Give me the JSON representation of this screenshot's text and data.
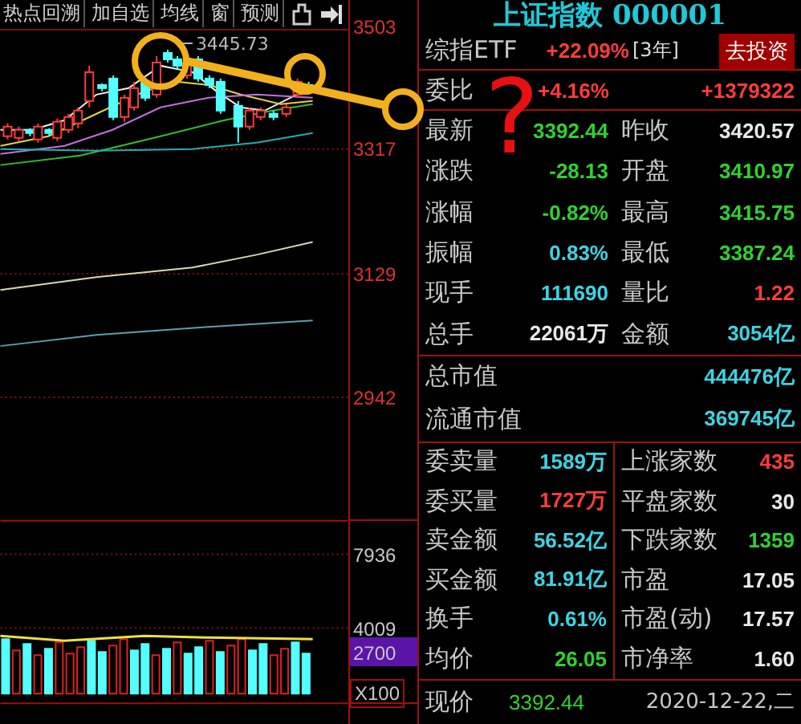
{
  "toolbar": {
    "tabs": [
      {
        "label": "热点回溯"
      },
      {
        "label": "加自选"
      },
      {
        "label": "均线"
      },
      {
        "label": "窗"
      },
      {
        "label": "预测"
      }
    ]
  },
  "chart": {
    "peak_label": "3445.73",
    "price_labels": [
      "3503",
      "3317",
      "3129",
      "2942"
    ],
    "volume_labels": [
      "7936",
      "4009"
    ],
    "volume_current": "2700",
    "volume_unit": "X100"
  },
  "annotation": {
    "mark": "?"
  },
  "quote": {
    "title": "上证指数 000001",
    "etf": {
      "label": "综指ETF",
      "change": "+22.09%",
      "period": "[3年]",
      "button": "去投资"
    },
    "ratio": {
      "label": "委比",
      "percent": "+4.16%",
      "diff": "+1379322"
    },
    "rows": [
      {
        "left": {
          "label": "最新",
          "value": "3392.44",
          "color": "#2fd22f"
        },
        "right": {
          "label": "昨收",
          "value": "3420.57",
          "color": "#e8e8e8"
        }
      },
      {
        "left": {
          "label": "涨跌",
          "value": "-28.13",
          "color": "#2fd22f"
        },
        "right": {
          "label": "开盘",
          "value": "3410.97",
          "color": "#2fd22f"
        }
      },
      {
        "left": {
          "label": "涨幅",
          "value": "-0.82%",
          "color": "#2fd22f"
        },
        "right": {
          "label": "最高",
          "value": "3415.75",
          "color": "#2fd22f"
        }
      },
      {
        "left": {
          "label": "振幅",
          "value": "0.83%",
          "color": "#3cd4e4"
        },
        "right": {
          "label": "最低",
          "value": "3387.24",
          "color": "#2fd22f"
        }
      },
      {
        "left": {
          "label": "现手",
          "value": "111690",
          "color": "#3cd4e4"
        },
        "right": {
          "label": "量比",
          "value": "1.22",
          "color": "#ff3c3c"
        }
      },
      {
        "left": {
          "label": "总手",
          "value": "22061万",
          "color": "#e8e8e8"
        },
        "right": {
          "label": "金额",
          "value": "3054亿",
          "color": "#3cd4e4"
        }
      }
    ],
    "caps": [
      {
        "label": "总市值",
        "value": "444476亿",
        "color": "#3cd4e4"
      },
      {
        "label": "流通市值",
        "value": "369745亿",
        "color": "#3cd4e4"
      }
    ],
    "grid": [
      {
        "left": {
          "label": "委卖量",
          "value": "1589万",
          "color": "#3cd4e4"
        },
        "right": {
          "label": "上涨家数",
          "value": "435",
          "color": "#ff3c3c"
        }
      },
      {
        "left": {
          "label": "委买量",
          "value": "1727万",
          "color": "#ff3c3c"
        },
        "right": {
          "label": "平盘家数",
          "value": "30",
          "color": "#e8e8e8"
        }
      },
      {
        "left": {
          "label": "卖金额",
          "value": "56.52亿",
          "color": "#3cd4e4"
        },
        "right": {
          "label": "下跌家数",
          "value": "1359",
          "color": "#2fd22f"
        }
      },
      {
        "left": {
          "label": "买金额",
          "value": "81.91亿",
          "color": "#3cd4e4"
        },
        "right": {
          "label": "市盈",
          "value": "17.05",
          "color": "#e8e8e8"
        }
      },
      {
        "left": {
          "label": "换手",
          "value": "0.61%",
          "color": "#3cd4e4"
        },
        "right": {
          "label": "市盈(动)",
          "value": "17.57",
          "color": "#e8e8e8"
        }
      },
      {
        "left": {
          "label": "均价",
          "value": "26.05",
          "color": "#2fd22f"
        },
        "right": {
          "label": "市净率",
          "value": "1.60",
          "color": "#e8e8e8"
        }
      }
    ],
    "current": {
      "label": "现价",
      "value": "3392.44",
      "color": "#2fd22f",
      "date": "2020-12-22,二"
    }
  }
}
